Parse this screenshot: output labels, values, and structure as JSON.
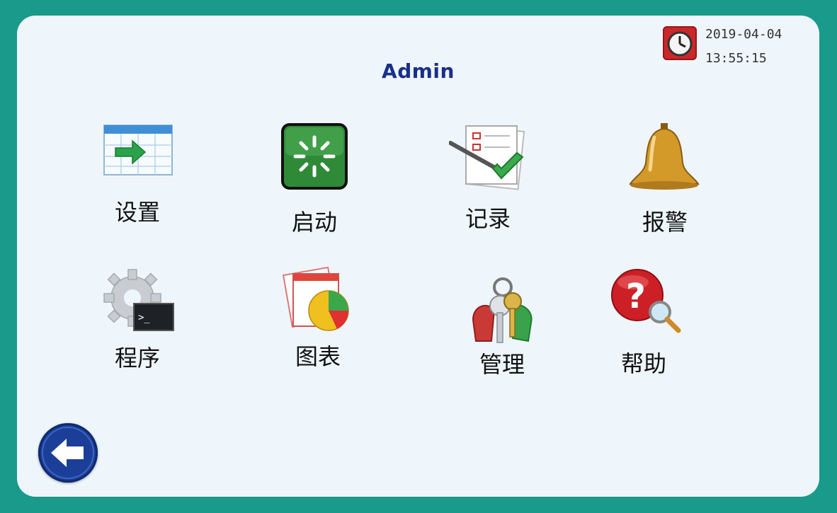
{
  "header": {
    "title": "Admin",
    "date": "2019-04-04",
    "time": "13:55:15",
    "clock_icon": "clock-icon"
  },
  "menu": [
    {
      "id": "settings",
      "label": "设置",
      "icon": "calendar-arrow-icon"
    },
    {
      "id": "start",
      "label": "启动",
      "icon": "start-spinner-icon"
    },
    {
      "id": "records",
      "label": "记录",
      "icon": "checklist-pen-icon"
    },
    {
      "id": "alarm",
      "label": "报警",
      "icon": "bell-icon"
    },
    {
      "id": "program",
      "label": "程序",
      "icon": "gear-terminal-icon"
    },
    {
      "id": "chart",
      "label": "图表",
      "icon": "pie-chart-icon"
    },
    {
      "id": "manage",
      "label": "管理",
      "icon": "keys-icon"
    },
    {
      "id": "help",
      "label": "帮助",
      "icon": "help-magnifier-icon"
    }
  ],
  "footer": {
    "back_icon": "back-arrow-icon"
  },
  "colors": {
    "frame": "#1a9a8a",
    "panel": "#eef6fb",
    "title": "#1a2f8a",
    "back_button": "#1b3f98"
  }
}
